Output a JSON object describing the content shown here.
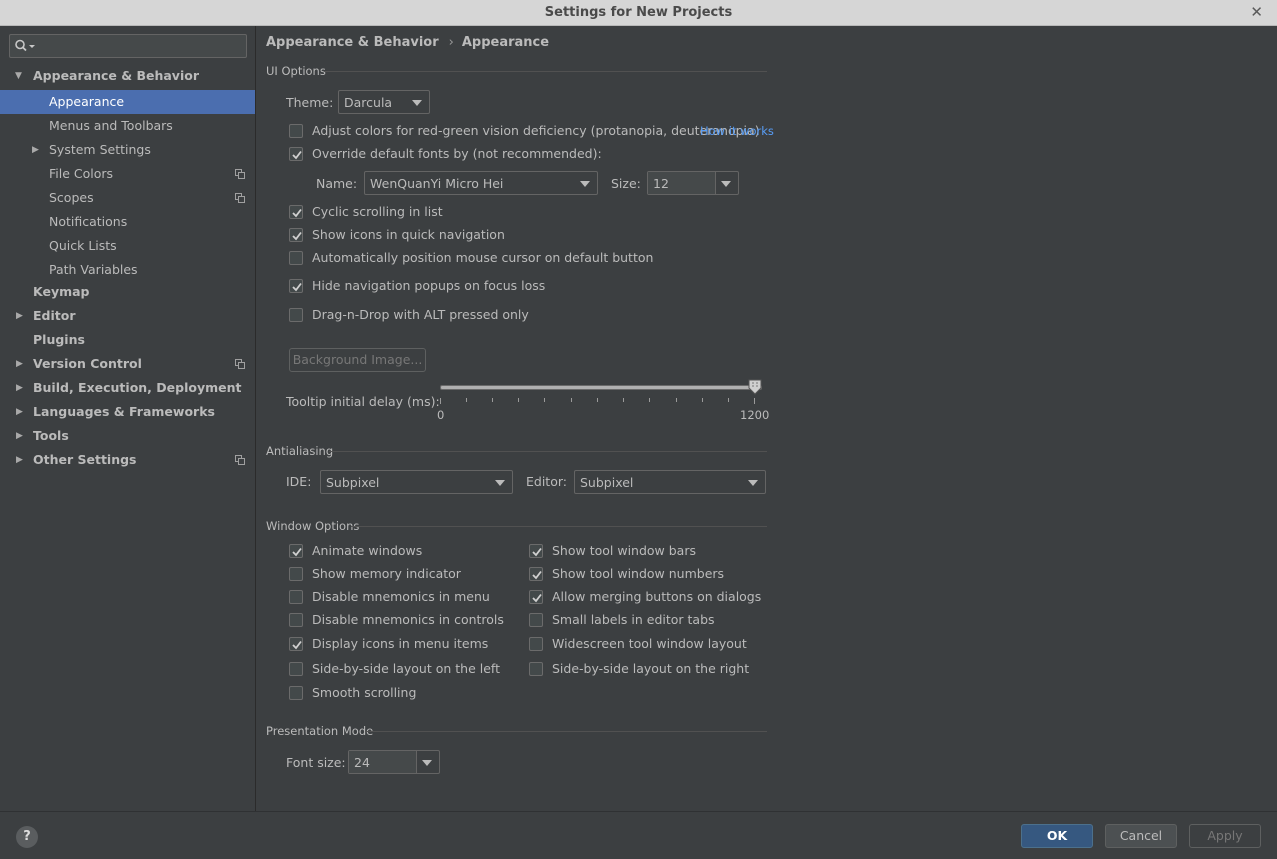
{
  "window": {
    "title": "Settings for New Projects"
  },
  "breadcrumb": {
    "parent": "Appearance & Behavior",
    "current": "Appearance"
  },
  "sidebar": {
    "items": [
      {
        "label": "Appearance & Behavior"
      },
      {
        "label": "Appearance"
      },
      {
        "label": "Menus and Toolbars"
      },
      {
        "label": "System Settings"
      },
      {
        "label": "File Colors"
      },
      {
        "label": "Scopes"
      },
      {
        "label": "Notifications"
      },
      {
        "label": "Quick Lists"
      },
      {
        "label": "Path Variables"
      },
      {
        "label": "Keymap"
      },
      {
        "label": "Editor"
      },
      {
        "label": "Plugins"
      },
      {
        "label": "Version Control"
      },
      {
        "label": "Build, Execution, Deployment"
      },
      {
        "label": "Languages & Frameworks"
      },
      {
        "label": "Tools"
      },
      {
        "label": "Other Settings"
      }
    ]
  },
  "ui_options": {
    "title": "UI Options",
    "theme_label": "Theme:",
    "theme_value": "Darcula",
    "color_deficiency_label": "Adjust colors for red-green vision deficiency (protanopia, deuteranopia)",
    "color_deficiency_checked": false,
    "how_it_works": "How it works",
    "override_fonts_label": "Override default fonts by (not recommended):",
    "override_fonts_checked": true,
    "font_name_label": "Name:",
    "font_name_value": "WenQuanYi Micro Hei",
    "font_size_label": "Size:",
    "font_size_value": "12",
    "cyclic_scrolling_label": "Cyclic scrolling in list",
    "cyclic_scrolling_checked": true,
    "show_icons_label": "Show icons in quick navigation",
    "show_icons_checked": true,
    "auto_position_label": "Automatically position mouse cursor on default button",
    "auto_position_checked": false,
    "hide_popups_label": "Hide navigation popups on focus loss",
    "hide_popups_checked": true,
    "drag_alt_label": "Drag-n-Drop with ALT pressed only",
    "drag_alt_checked": false,
    "background_image_button": "Background Image...",
    "tooltip_delay_label": "Tooltip initial delay (ms):",
    "tooltip_min": "0",
    "tooltip_max": "1200",
    "tooltip_value": 1200
  },
  "antialiasing": {
    "title": "Antialiasing",
    "ide_label": "IDE:",
    "ide_value": "Subpixel",
    "editor_label": "Editor:",
    "editor_value": "Subpixel"
  },
  "window_options": {
    "title": "Window Options",
    "left": [
      {
        "label": "Animate windows",
        "checked": true
      },
      {
        "label": "Show memory indicator",
        "checked": false
      },
      {
        "label": "Disable mnemonics in menu",
        "checked": false
      },
      {
        "label": "Disable mnemonics in controls",
        "checked": false
      },
      {
        "label": "Display icons in menu items",
        "checked": true
      },
      {
        "label": "Side-by-side layout on the left",
        "checked": false
      },
      {
        "label": "Smooth scrolling",
        "checked": false
      }
    ],
    "right": [
      {
        "label": "Show tool window bars",
        "checked": true
      },
      {
        "label": "Show tool window numbers",
        "checked": true
      },
      {
        "label": "Allow merging buttons on dialogs",
        "checked": true
      },
      {
        "label": "Small labels in editor tabs",
        "checked": false
      },
      {
        "label": "Widescreen tool window layout",
        "checked": false
      },
      {
        "label": "Side-by-side layout on the right",
        "checked": false
      }
    ]
  },
  "presentation_mode": {
    "title": "Presentation Mode",
    "font_size_label": "Font size:",
    "font_size_value": "24"
  },
  "footer": {
    "help": "?",
    "ok": "OK",
    "cancel": "Cancel",
    "apply": "Apply"
  },
  "colors": {
    "background": "#3c3f41",
    "selection": "#4b6eaf",
    "link": "#589df6",
    "default_button": "#365880"
  }
}
